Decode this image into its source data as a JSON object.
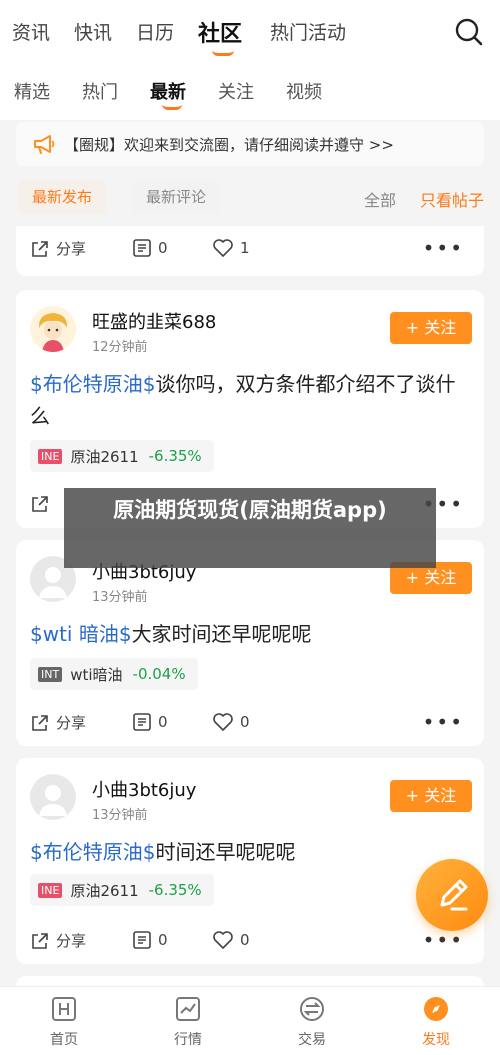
{
  "top_tabs": [
    "资讯",
    "快讯",
    "日历",
    "社区",
    "热门活动"
  ],
  "top_active": "社区",
  "sub_tabs": [
    "精选",
    "热门",
    "最新",
    "关注",
    "视频"
  ],
  "sub_active": "最新",
  "notice": "【圈规】欢迎来到交流圈，请仔细阅读并遵守 >>",
  "filters": {
    "latest_post": "最新发布",
    "latest_comment": "最新评论",
    "all": "全部",
    "only_posts": "只看帖子"
  },
  "share_label": "分享",
  "follow_label": "+ 关注",
  "first_card": {
    "comments": "0",
    "likes": "1"
  },
  "posts": [
    {
      "user": "旺盛的韭菜688",
      "time": "12分钟前",
      "tag": "$布伦特原油$",
      "text": "谈你吗，双方条件都介绍不了谈什么",
      "quote_badge": "INE",
      "quote_name": "原油2611",
      "quote_change": "-6.35%"
    },
    {
      "user": "小曲3bt6juy",
      "time": "13分钟前",
      "tag": "$wti 暗油$",
      "text": "大家时间还早呢呢呢",
      "quote_badge": "INT",
      "quote_name": "wti暗油",
      "quote_change": "-0.04%",
      "comments": "0",
      "likes": "0"
    },
    {
      "user": "小曲3bt6juy",
      "time": "13分钟前",
      "tag": "$布伦特原油$",
      "text": "时间还早呢呢呢",
      "quote_badge": "INE",
      "quote_name": "原油2611",
      "quote_change": "-6.35%",
      "comments": "0",
      "likes": "0"
    }
  ],
  "overlay_title": "原油期货现货(原油期货app)",
  "bottom_nav": [
    "首页",
    "行情",
    "交易",
    "发现"
  ],
  "bottom_active": "发现",
  "colors": {
    "accent": "#ff7a1a",
    "tag_blue": "#2a6bc9",
    "change_green": "#1da04a"
  }
}
